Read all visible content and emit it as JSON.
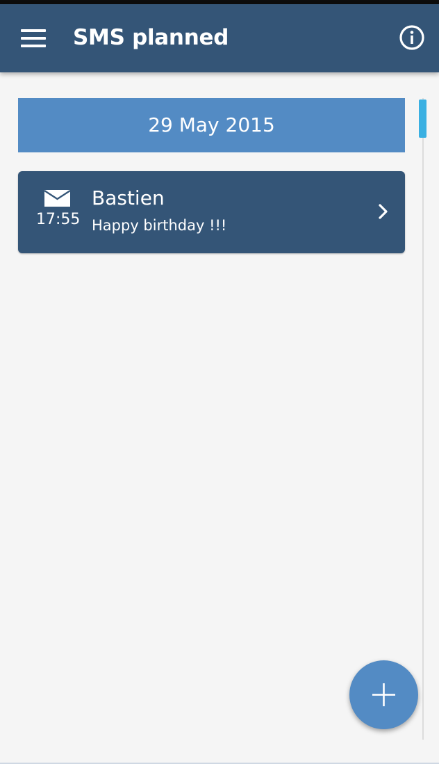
{
  "app_bar": {
    "title": "SMS planned",
    "menu_icon": "hamburger-menu-icon",
    "info_icon": "info-circle-icon",
    "background": "#345577"
  },
  "schedule": {
    "date_header": "29 May 2015",
    "items": [
      {
        "icon": "envelope-icon",
        "time": "17:55",
        "recipient": "Bastien",
        "message": "Happy birthday !!!",
        "action_icon": "chevron-right-icon"
      }
    ]
  },
  "fab": {
    "icon": "plus-icon",
    "color": "#538bc4"
  },
  "colors": {
    "primary_dark": "#345577",
    "primary": "#538bc4",
    "scroll_thumb": "#3ab0e2",
    "background": "#f5f5f5"
  }
}
